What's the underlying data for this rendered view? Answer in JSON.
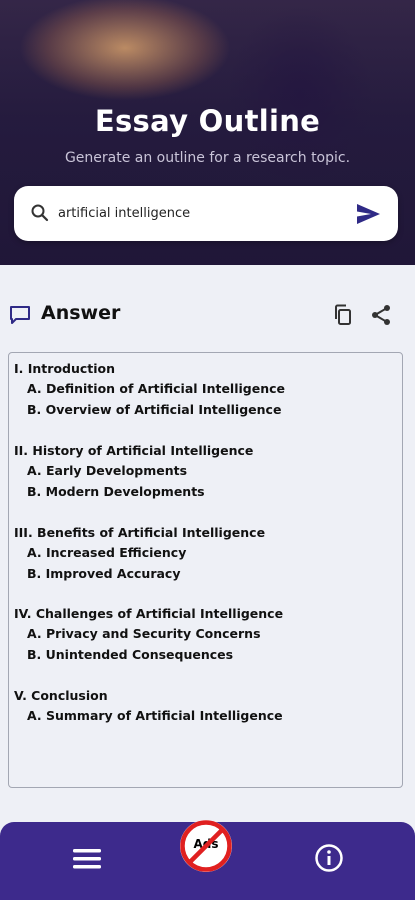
{
  "header": {
    "title": "Essay Outline",
    "subtitle": "Generate an outline for a research topic."
  },
  "search": {
    "value": "artificial intelligence",
    "icon": "search-icon",
    "send_icon": "send-icon"
  },
  "answer": {
    "title": "Answer",
    "icons": [
      "chat-icon",
      "copy-icon",
      "share-icon"
    ]
  },
  "outline": [
    {
      "text": "I. Introduction",
      "level": 1
    },
    {
      "text": "A. Definition of Artificial Intelligence",
      "level": 2
    },
    {
      "text": "B. Overview of Artificial Intelligence",
      "level": 2
    },
    {
      "text": "II. History of Artificial Intelligence",
      "level": 1
    },
    {
      "text": "A. Early Developments",
      "level": 2
    },
    {
      "text": "B. Modern Developments",
      "level": 2
    },
    {
      "text": "III. Benefits of Artificial Intelligence",
      "level": 1
    },
    {
      "text": "A. Increased Efficiency",
      "level": 2
    },
    {
      "text": "B. Improved Accuracy",
      "level": 2
    },
    {
      "text": "IV. Challenges of Artificial Intelligence",
      "level": 1
    },
    {
      "text": "A. Privacy and Security Concerns",
      "level": 2
    },
    {
      "text": "B. Unintended Consequences",
      "level": 2
    },
    {
      "text": "V. Conclusion",
      "level": 1
    },
    {
      "text": "A. Summary of Artificial Intelligence",
      "level": 2
    }
  ],
  "bottom_bar": {
    "ads_label": "Ads",
    "icons": [
      "menu-icon",
      "no-ads-icon",
      "info-icon"
    ]
  },
  "colors": {
    "accent": "#3d2a8c",
    "no_ads_red": "#e02020"
  }
}
